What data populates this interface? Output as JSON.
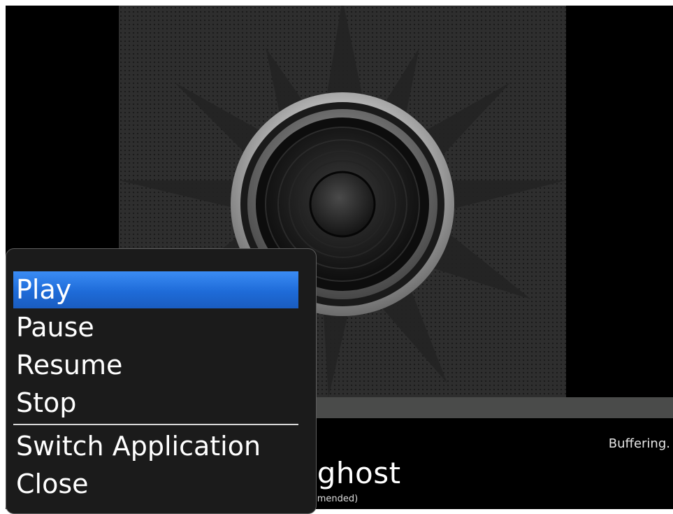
{
  "player": {
    "status_text": "Buffering.",
    "track_title": "icghost",
    "track_subtitle": "ecommended)"
  },
  "menu": {
    "items": [
      {
        "label": "Play",
        "selected": true
      },
      {
        "label": "Pause",
        "selected": false
      },
      {
        "label": "Resume",
        "selected": false
      },
      {
        "label": "Stop",
        "selected": false
      },
      {
        "label": "Switch Application",
        "selected": false
      },
      {
        "label": "Close",
        "selected": false
      }
    ]
  },
  "colors": {
    "selection": "#2a78e8",
    "menu_background": "#1b1b1b",
    "progress_bar": "#4a4b4a",
    "screen_background": "#000000"
  },
  "icons": {
    "album_art": "speaker-icon"
  }
}
